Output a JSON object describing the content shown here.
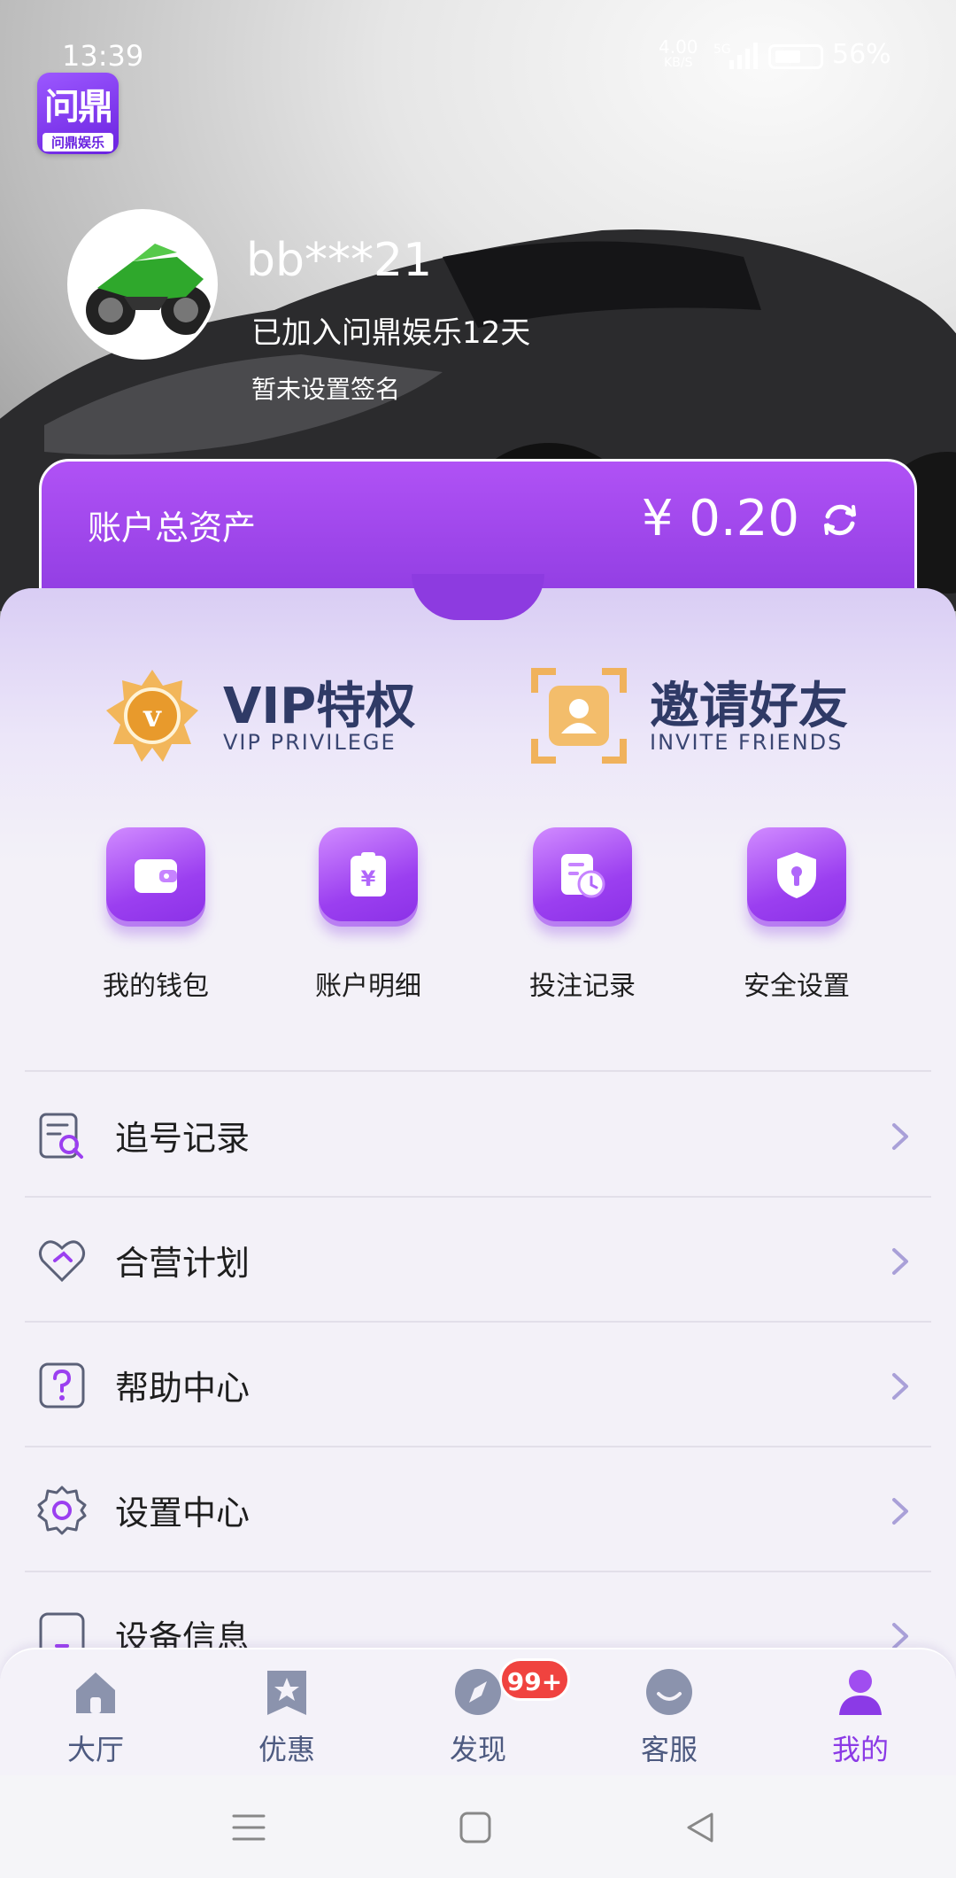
{
  "status_bar": {
    "time": "13:39",
    "net_speed": "4.00",
    "net_unit": "KB/S",
    "network_type": "5G",
    "battery": "56%"
  },
  "app": {
    "logo_main": "问鼎",
    "logo_sub": "问鼎娱乐"
  },
  "profile": {
    "username": "bb***21",
    "joined": "已加入问鼎娱乐12天",
    "signature": "暂未设置签名"
  },
  "assets": {
    "label": "账户总资产",
    "value": "¥ 0.20"
  },
  "promos": [
    {
      "title": "VIP特权",
      "subtitle": "VIP PRIVILEGE"
    },
    {
      "title": "邀请好友",
      "subtitle": "INVITE FRIENDS"
    }
  ],
  "quick_actions": [
    {
      "label": "我的钱包",
      "icon": "wallet-icon"
    },
    {
      "label": "账户明细",
      "icon": "bill-icon"
    },
    {
      "label": "投注记录",
      "icon": "record-clock-icon"
    },
    {
      "label": "安全设置",
      "icon": "shield-icon"
    }
  ],
  "menu": [
    {
      "label": "追号记录",
      "icon": "search-doc-icon"
    },
    {
      "label": "合营计划",
      "icon": "handshake-icon"
    },
    {
      "label": "帮助中心",
      "icon": "question-icon"
    },
    {
      "label": "设置中心",
      "icon": "gear-icon"
    },
    {
      "label": "设备信息",
      "icon": "device-icon"
    }
  ],
  "tabs": [
    {
      "label": "大厅",
      "icon": "home-icon"
    },
    {
      "label": "优惠",
      "icon": "star-bookmark-icon"
    },
    {
      "label": "发现",
      "icon": "compass-icon"
    },
    {
      "label": "客服",
      "icon": "smile-icon"
    },
    {
      "label": "我的",
      "icon": "user-icon",
      "active": true
    }
  ],
  "discover_badge": "99+",
  "colors": {
    "accent": "#8b3ae6",
    "badge": "#f0433f",
    "text_dark": "#2f3a66"
  }
}
